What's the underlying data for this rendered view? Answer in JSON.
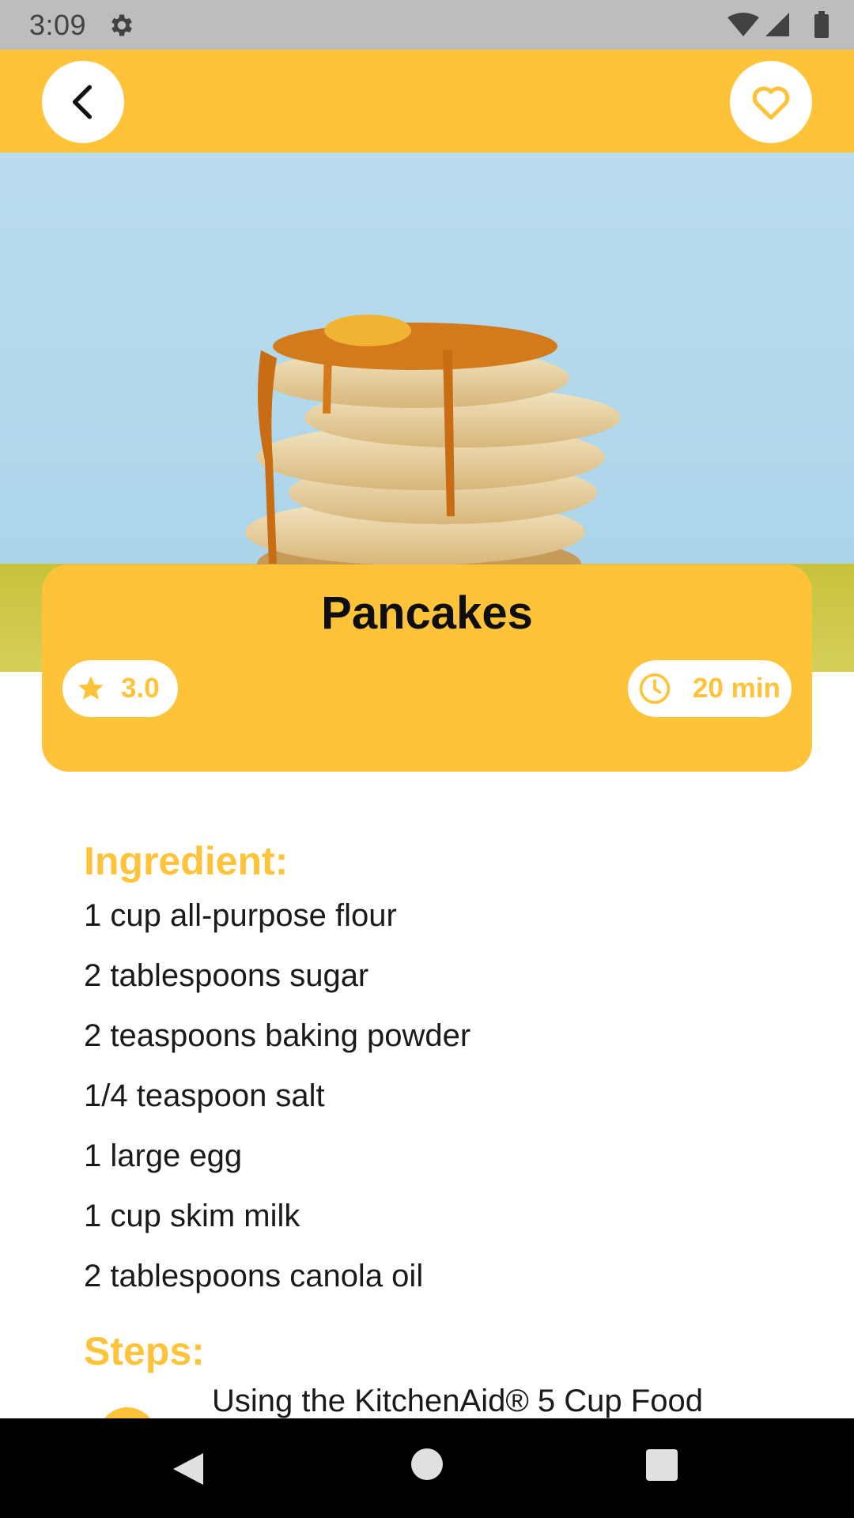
{
  "status_bar": {
    "time": "3:09"
  },
  "recipe": {
    "title": "Pancakes",
    "rating": "3.0",
    "time": "20 min"
  },
  "ingredients": {
    "heading": "Ingredient:",
    "items": [
      "1 cup all-purpose flour",
      "2 tablespoons sugar",
      "2 teaspoons baking powder",
      "1/4 teaspoon salt",
      "1 large egg",
      "1 cup skim milk",
      "2 tablespoons canola oil"
    ]
  },
  "steps": {
    "heading": "Steps:",
    "items": [
      "Using the KitchenAid® 5 Cup Food"
    ]
  },
  "colors": {
    "accent": "#ffc33a",
    "text": "#1a1a1a",
    "status_bar": "#bdbdbd",
    "nav_bar": "#000000"
  },
  "icons": {
    "back": "arrow-back-icon",
    "favorite": "heart-outline-icon",
    "rating": "star-icon",
    "time": "clock-icon",
    "settings": "gear-icon"
  }
}
